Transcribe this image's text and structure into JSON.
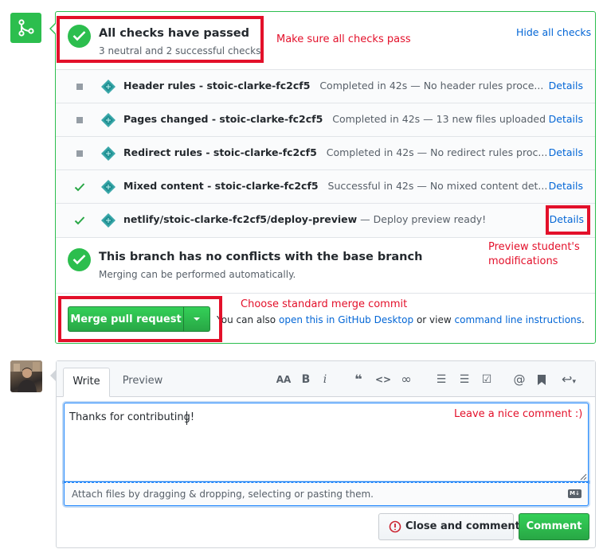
{
  "merge_status": {
    "icon": "git-merge-icon",
    "title": "All checks have passed",
    "subtitle": "3 neutral and 2 successful checks",
    "hide_checks_label": "Hide all checks"
  },
  "checks": [
    {
      "status": "neutral",
      "name": "Header rules - stoic-clarke-fc2cf5",
      "description": "Completed in 42s — No header rules proce...",
      "details_label": "Details"
    },
    {
      "status": "neutral",
      "name": "Pages changed - stoic-clarke-fc2cf5",
      "description": "Completed in 42s — 13 new files uploaded",
      "details_label": "Details"
    },
    {
      "status": "neutral",
      "name": "Redirect rules - stoic-clarke-fc2cf5",
      "description": "Completed in 42s — No redirect rules proc...",
      "details_label": "Details"
    },
    {
      "status": "success",
      "name": "Mixed content - stoic-clarke-fc2cf5",
      "description": "Successful in 42s — No mixed content det...",
      "details_label": "Details"
    },
    {
      "status": "success",
      "name": "netlify/stoic-clarke-fc2cf5/deploy-preview",
      "description": "— Deploy preview ready!",
      "details_label": "Details"
    }
  ],
  "conflicts": {
    "title": "This branch has no conflicts with the base branch",
    "subtitle": "Merging can be performed automatically."
  },
  "merge": {
    "button_label": "Merge pull request",
    "alt_prefix": "You can also",
    "alt_link1": "open this in GitHub Desktop",
    "alt_middle": "or view",
    "alt_link2": "command line instructions",
    "alt_suffix": "."
  },
  "annotations": {
    "checks": "Make sure all checks pass",
    "preview_line1": "Preview student's",
    "preview_line2": "modifications",
    "merge": "Choose standard merge commit",
    "comment": "Leave a nice comment :)"
  },
  "comment_form": {
    "tab_write": "Write",
    "tab_preview": "Preview",
    "toolbar": {
      "header": "AA",
      "bold": "B",
      "italic": "i",
      "quote": "❝",
      "code": "<>",
      "link": "∞",
      "bullets": "☰",
      "numbered": "☰",
      "tasks": "☑",
      "mention": "@",
      "bookmark": "🔖",
      "reply": "↩"
    },
    "text": "Thanks for contributing!",
    "attach_hint": "Attach files by dragging & dropping, selecting or pasting them.",
    "markdown_badge": "M↓",
    "close_label": "Close and comment",
    "comment_label": "Comment"
  },
  "colors": {
    "success": "#2cbe4e",
    "link": "#0366d6",
    "annotation": "#e3102a"
  }
}
